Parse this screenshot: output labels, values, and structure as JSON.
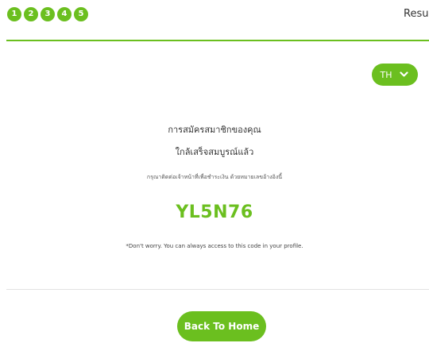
{
  "steps": [
    "1",
    "2",
    "3",
    "4",
    "5"
  ],
  "header": {
    "result_label": "Result"
  },
  "language": {
    "label": "TH",
    "icon": "chevron-down-icon"
  },
  "message": {
    "title_line_1": "การสมัครสมาชิกของคุณ",
    "title_line_2": "ใกล้เสร็จสมบูรณ์แล้ว",
    "instruction": "กรุณาติดต่อเจ้าหน้าที่เพื่อชำระเงิน ด้วยหมายเลขอ้างอิงนี้"
  },
  "code": {
    "value": "YL5N76"
  },
  "note": "*Don't worry. You can always access to this code in your profile.",
  "actions": {
    "back_to_home": "Back To Home"
  },
  "colors": {
    "accent": "#6bbf1f",
    "text": "#333333",
    "divider": "#e2e2e2"
  }
}
